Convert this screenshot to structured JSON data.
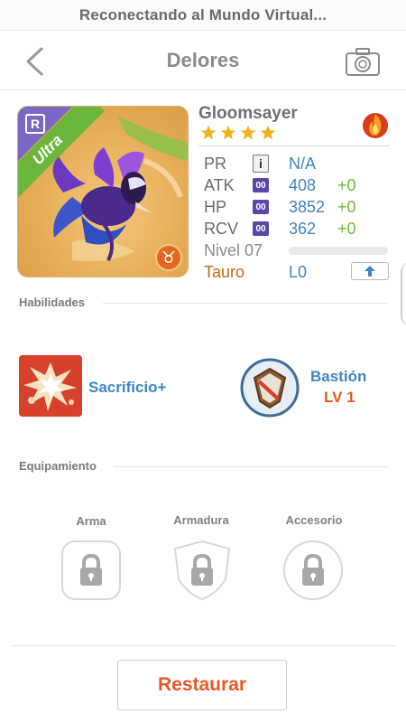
{
  "status_bar": {
    "text": "Reconectando al Mundo Virtual..."
  },
  "nav": {
    "title": "Delores",
    "back_icon": "chevron-left-icon",
    "camera_icon": "camera-icon"
  },
  "monster": {
    "name": "Gloomsayer",
    "stars": 4,
    "rarity_letter": "R",
    "rarity_label": "Ultra",
    "zodiac_symbol": "♉",
    "element_icon": "fire-icon",
    "stats": {
      "pr": {
        "label": "PR",
        "chip": "i",
        "value": "N/A"
      },
      "atk": {
        "label": "ATK",
        "chip": "00",
        "value": "408",
        "bonus": "+0"
      },
      "hp": {
        "label": "HP",
        "chip": "00",
        "value": "3852",
        "bonus": "+0"
      },
      "rcv": {
        "label": "RCV",
        "chip": "00",
        "value": "362",
        "bonus": "+0"
      }
    },
    "level": {
      "label": "Nivel 07",
      "progress": 0
    },
    "sign": {
      "label": "Tauro",
      "rank": "L0",
      "upgrade_icon": "arrow-up-icon"
    }
  },
  "skills": {
    "heading": "Habilidades",
    "active": {
      "name": "Sacrificio+"
    },
    "passive": {
      "name": "Bastión",
      "level": "LV 1"
    }
  },
  "equipment": {
    "heading": "Equipamiento",
    "slots": [
      {
        "label": "Arma",
        "locked": true
      },
      {
        "label": "Armadura",
        "locked": true
      },
      {
        "label": "Accesorio",
        "locked": true
      }
    ]
  },
  "footer": {
    "restore_label": "Restaurar"
  },
  "colors": {
    "accent_blue": "#3e85c6",
    "accent_orange": "#ea5a26",
    "bonus_green": "#6fbb3a",
    "stat_chip": "#5a47a8"
  }
}
